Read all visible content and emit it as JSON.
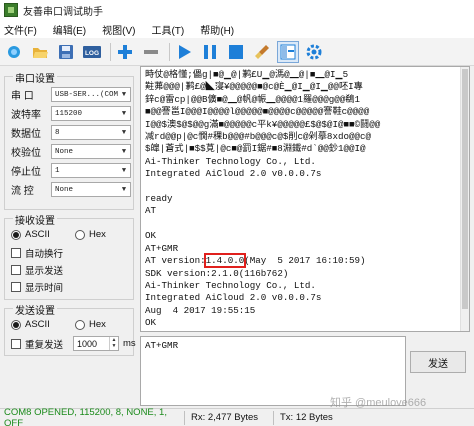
{
  "window": {
    "title": "友善串口调试助手"
  },
  "menu": [
    "文件(F)",
    "编辑(E)",
    "视图(V)",
    "工具(T)",
    "帮助(H)"
  ],
  "toolbar": {
    "icons": [
      "new-icon",
      "open-folder-icon",
      "save-icon",
      "log-icon",
      "add-icon",
      "remove-icon",
      "play-icon",
      "pause-icon",
      "stop-icon",
      "clear-brush-icon",
      "layout-icon",
      "settings-gear-icon"
    ],
    "log_label": "LOG"
  },
  "serial_settings": {
    "title": "串口设置",
    "port_label": "串  口",
    "port_value": "USB-SER...(COM8",
    "baud_label": "波特率",
    "baud_value": "115200",
    "databits_label": "数据位",
    "databits_value": "8",
    "parity_label": "校验位",
    "parity_value": "None",
    "stopbits_label": "停止位",
    "stopbits_value": "1",
    "flow_label": "流  控",
    "flow_value": "None"
  },
  "receive_settings": {
    "title": "接收设置",
    "ascii_label": "ASCII",
    "hex_label": "Hex",
    "selected": "ASCII",
    "auto_newline_label": "自动换行",
    "show_send_label": "显示发送",
    "show_time_label": "显示时间"
  },
  "send_settings": {
    "title": "发送设置",
    "ascii_label": "ASCII",
    "hex_label": "Hex",
    "selected": "ASCII",
    "repeat_label": "重复发送",
    "interval_value": "1000",
    "interval_unit": "ms"
  },
  "output": {
    "garbage_1": "畤仗@格懂;儡g|■@▁@|鹣£U▁@溤@▁@|■▁@I▁5",
    "garbage_2": "黈茀@@@|鹣£@◣寖¥@@@@@■@c@Ѐ▁@I▁@I▁@@呸I專",
    "garbage_3": "鋅c@雷cp|@@B儣■@▁@帆@帪▁@@@@1羅@@@g@@鵗1",
    "garbage_4": "■@@謇邕I@@@I@@@@l@@@@@■@@@@c@@@@@謇鞋c@@@@",
    "garbage_5": "I@@$澳$@$@@g滿■@@@@@c平k¥@@@@@£$@$@I@■■©鬪@@",
    "garbage_6": "减rd@@p|@c憪#稞b@@@#b@@@c@$削c@剁摹8xdo@@c@",
    "garbage_7": "$皥|蒼式|■$$莧|@c■@罰I鋸#■8淵鐵#d`@@鈔1@@I@",
    "line_company_1": "Ai-Thinker Technology Co., Ltd.",
    "line_aicloud_1": "Integrated AiCloud 2.0 v0.0.0.7s",
    "line_ready": "ready",
    "line_at": "AT",
    "line_ok_1": "OK",
    "line_at_gmr": "AT+GMR",
    "line_version_prefix": "AT version:",
    "line_version_number": "1.4.0.0",
    "line_version_suffix": "(May  5 2017 16:10:59)",
    "line_sdk": "SDK version:2.1.0(116b762)",
    "line_company_2": "Ai-Thinker Technology Co., Ltd.",
    "line_aicloud_2": "Integrated AiCloud 2.0 v0.0.0.7s",
    "line_date": "Aug  4 2017 19:55:15",
    "line_ok_2": "OK"
  },
  "input": {
    "value": "AT+GMR"
  },
  "send_button": "发送",
  "status": {
    "port": "COM8 OPENED, 115200, 8, NONE, 1, OFF",
    "rx": "Rx: 2,477 Bytes",
    "tx": "Tx: 12 Bytes"
  },
  "watermark": "知乎 @meulove666",
  "colors": {
    "status_green": "#1a8a1a",
    "highlight_red": "#e0201d",
    "toolbar_blue": "#1e7fd8"
  }
}
